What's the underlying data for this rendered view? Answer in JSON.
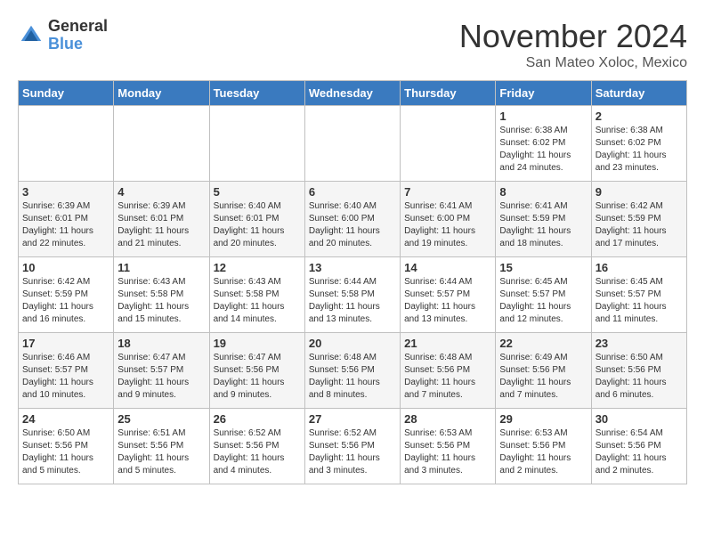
{
  "logo": {
    "general": "General",
    "blue": "Blue"
  },
  "header": {
    "month": "November 2024",
    "location": "San Mateo Xoloc, Mexico"
  },
  "weekdays": [
    "Sunday",
    "Monday",
    "Tuesday",
    "Wednesday",
    "Thursday",
    "Friday",
    "Saturday"
  ],
  "weeks": [
    [
      {
        "day": "",
        "info": ""
      },
      {
        "day": "",
        "info": ""
      },
      {
        "day": "",
        "info": ""
      },
      {
        "day": "",
        "info": ""
      },
      {
        "day": "",
        "info": ""
      },
      {
        "day": "1",
        "info": "Sunrise: 6:38 AM\nSunset: 6:02 PM\nDaylight: 11 hours and 24 minutes."
      },
      {
        "day": "2",
        "info": "Sunrise: 6:38 AM\nSunset: 6:02 PM\nDaylight: 11 hours and 23 minutes."
      }
    ],
    [
      {
        "day": "3",
        "info": "Sunrise: 6:39 AM\nSunset: 6:01 PM\nDaylight: 11 hours and 22 minutes."
      },
      {
        "day": "4",
        "info": "Sunrise: 6:39 AM\nSunset: 6:01 PM\nDaylight: 11 hours and 21 minutes."
      },
      {
        "day": "5",
        "info": "Sunrise: 6:40 AM\nSunset: 6:01 PM\nDaylight: 11 hours and 20 minutes."
      },
      {
        "day": "6",
        "info": "Sunrise: 6:40 AM\nSunset: 6:00 PM\nDaylight: 11 hours and 20 minutes."
      },
      {
        "day": "7",
        "info": "Sunrise: 6:41 AM\nSunset: 6:00 PM\nDaylight: 11 hours and 19 minutes."
      },
      {
        "day": "8",
        "info": "Sunrise: 6:41 AM\nSunset: 5:59 PM\nDaylight: 11 hours and 18 minutes."
      },
      {
        "day": "9",
        "info": "Sunrise: 6:42 AM\nSunset: 5:59 PM\nDaylight: 11 hours and 17 minutes."
      }
    ],
    [
      {
        "day": "10",
        "info": "Sunrise: 6:42 AM\nSunset: 5:59 PM\nDaylight: 11 hours and 16 minutes."
      },
      {
        "day": "11",
        "info": "Sunrise: 6:43 AM\nSunset: 5:58 PM\nDaylight: 11 hours and 15 minutes."
      },
      {
        "day": "12",
        "info": "Sunrise: 6:43 AM\nSunset: 5:58 PM\nDaylight: 11 hours and 14 minutes."
      },
      {
        "day": "13",
        "info": "Sunrise: 6:44 AM\nSunset: 5:58 PM\nDaylight: 11 hours and 13 minutes."
      },
      {
        "day": "14",
        "info": "Sunrise: 6:44 AM\nSunset: 5:57 PM\nDaylight: 11 hours and 13 minutes."
      },
      {
        "day": "15",
        "info": "Sunrise: 6:45 AM\nSunset: 5:57 PM\nDaylight: 11 hours and 12 minutes."
      },
      {
        "day": "16",
        "info": "Sunrise: 6:45 AM\nSunset: 5:57 PM\nDaylight: 11 hours and 11 minutes."
      }
    ],
    [
      {
        "day": "17",
        "info": "Sunrise: 6:46 AM\nSunset: 5:57 PM\nDaylight: 11 hours and 10 minutes."
      },
      {
        "day": "18",
        "info": "Sunrise: 6:47 AM\nSunset: 5:57 PM\nDaylight: 11 hours and 9 minutes."
      },
      {
        "day": "19",
        "info": "Sunrise: 6:47 AM\nSunset: 5:56 PM\nDaylight: 11 hours and 9 minutes."
      },
      {
        "day": "20",
        "info": "Sunrise: 6:48 AM\nSunset: 5:56 PM\nDaylight: 11 hours and 8 minutes."
      },
      {
        "day": "21",
        "info": "Sunrise: 6:48 AM\nSunset: 5:56 PM\nDaylight: 11 hours and 7 minutes."
      },
      {
        "day": "22",
        "info": "Sunrise: 6:49 AM\nSunset: 5:56 PM\nDaylight: 11 hours and 7 minutes."
      },
      {
        "day": "23",
        "info": "Sunrise: 6:50 AM\nSunset: 5:56 PM\nDaylight: 11 hours and 6 minutes."
      }
    ],
    [
      {
        "day": "24",
        "info": "Sunrise: 6:50 AM\nSunset: 5:56 PM\nDaylight: 11 hours and 5 minutes."
      },
      {
        "day": "25",
        "info": "Sunrise: 6:51 AM\nSunset: 5:56 PM\nDaylight: 11 hours and 5 minutes."
      },
      {
        "day": "26",
        "info": "Sunrise: 6:52 AM\nSunset: 5:56 PM\nDaylight: 11 hours and 4 minutes."
      },
      {
        "day": "27",
        "info": "Sunrise: 6:52 AM\nSunset: 5:56 PM\nDaylight: 11 hours and 3 minutes."
      },
      {
        "day": "28",
        "info": "Sunrise: 6:53 AM\nSunset: 5:56 PM\nDaylight: 11 hours and 3 minutes."
      },
      {
        "day": "29",
        "info": "Sunrise: 6:53 AM\nSunset: 5:56 PM\nDaylight: 11 hours and 2 minutes."
      },
      {
        "day": "30",
        "info": "Sunrise: 6:54 AM\nSunset: 5:56 PM\nDaylight: 11 hours and 2 minutes."
      }
    ]
  ]
}
